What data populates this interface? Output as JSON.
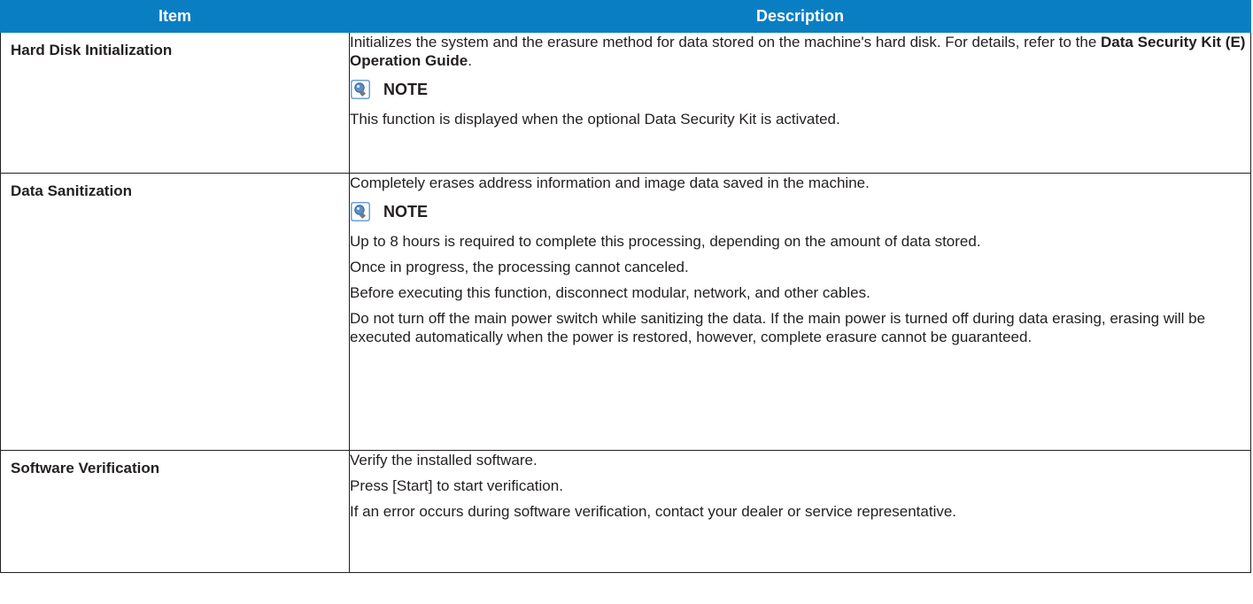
{
  "header": {
    "item": "Item",
    "description": "Description"
  },
  "rows": [
    {
      "item": "Hard Disk Initialization",
      "desc_intro": "Initializes the system and the erasure method for data stored on the machine's hard disk. For details, refer to the ",
      "desc_bold": "Data Security Kit (E) Operation Guide",
      "desc_end": ".",
      "note_label": "NOTE",
      "notes": [
        "This function is displayed when the optional Data Security Kit is activated."
      ]
    },
    {
      "item": "Data Sanitization",
      "desc": "Completely erases address information and image data saved in the machine.",
      "note_label": "NOTE",
      "notes": [
        "Up to 8 hours is required to complete this processing, depending on the amount of data stored.",
        "Once in progress, the processing cannot canceled.",
        "Before executing this function, disconnect modular, network, and other cables.",
        "Do not turn off the main power switch while sanitizing the data. If the main power is turned off during data erasing, erasing will be executed automatically when the power is restored, however, complete erasure cannot be guaranteed."
      ]
    },
    {
      "item": "Software Verification",
      "lines": [
        "Verify the installed software.",
        "Press [Start] to start verification.",
        "If an error occurs during software verification, contact your dealer or service representative."
      ]
    }
  ],
  "icons": {
    "note": "note-lightbulb-icon"
  },
  "colors": {
    "header_bg": "#0a7ec2",
    "header_text": "#ffffff",
    "note_icon": "#5b8fc8"
  }
}
